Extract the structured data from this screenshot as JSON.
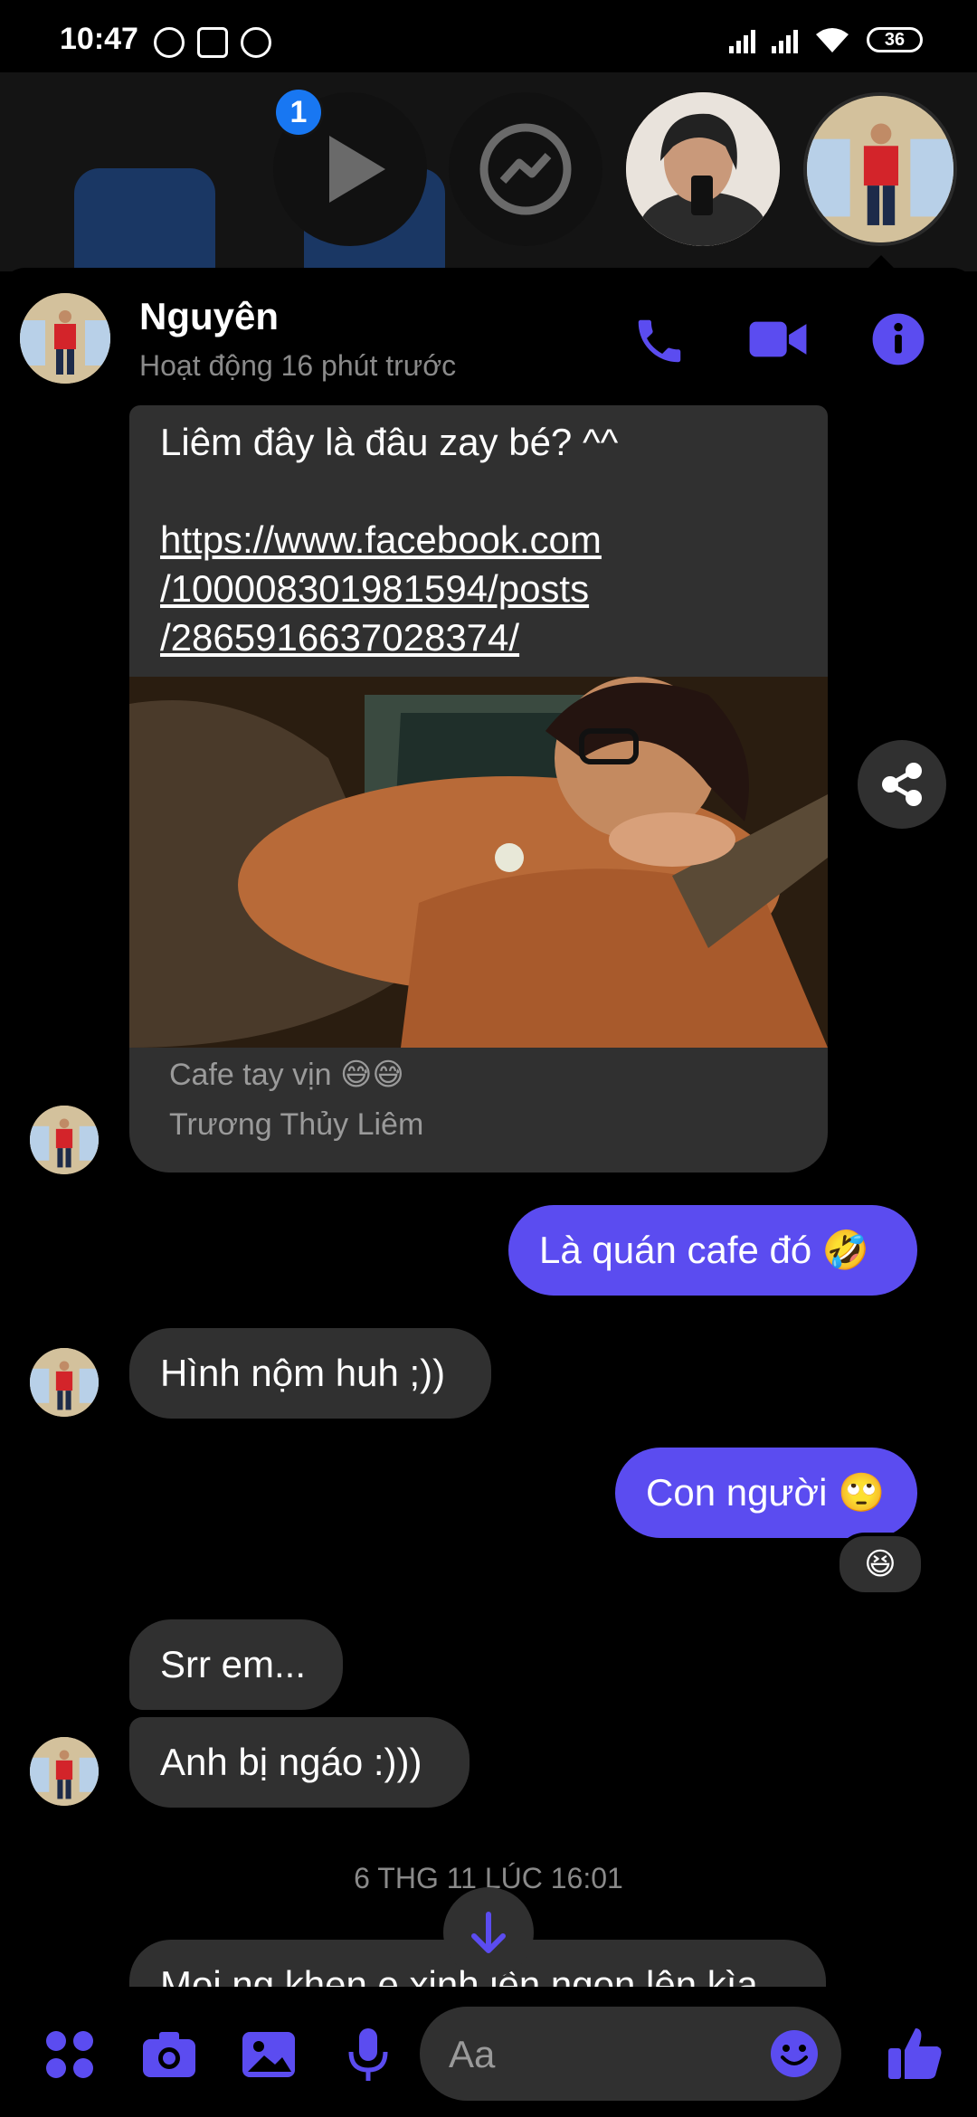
{
  "status_bar": {
    "time": "10:47",
    "battery": "36"
  },
  "chat_heads": {
    "badge_count": "1"
  },
  "header": {
    "name": "Nguyên",
    "activity": "Hoạt động 16 phút trước"
  },
  "messages": {
    "shared_post": {
      "text": "Liêm đây là đâu zay bé? ^^",
      "link_line1": "https://www.facebook.com",
      "link_line2": "/100008301981594/posts",
      "link_line3": "/2865916637028374/",
      "caption": "Cafe tay vịn 😅😅",
      "author": "Trương Thủy Liêm"
    },
    "m1": "Là quán cafe đó 🤣",
    "m2": "Hình nộm huh ;))",
    "m3": "Con người 🙄",
    "m3_reaction": "😆",
    "m4": "Srr em...",
    "m5": "Anh bị ngáo :)))",
    "timestamp": "6 THG 11 LÚC 16:01",
    "m6_partial": "Mọi ng khen e xinh lên ngon lên kìa"
  },
  "composer": {
    "placeholder": "Aa"
  },
  "colors": {
    "accent": "#5b4cf0",
    "incoming_bubble": "#303030",
    "background": "#000000"
  }
}
